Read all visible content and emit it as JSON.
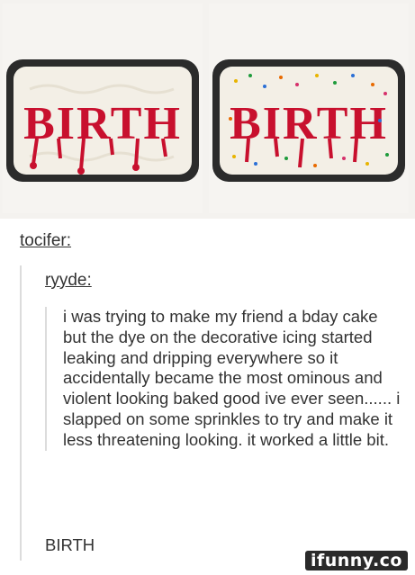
{
  "post": {
    "op_username": "tocifer:",
    "reblog_username": "ryyde:",
    "body_text": "i was trying to make my friend a bday cake but the dye on the decorative icing started leaking and dripping everywhere so it accidentally became the most ominous and violent looking baked good ive ever seen...... i slapped on some sprinkles to try and make it less threatening looking. it worked a little bit.",
    "reply_text": "BIRTH"
  },
  "images": {
    "left_cake_text": "BIRTH",
    "right_cake_text": "BIRTH"
  },
  "watermark": {
    "text": "ifunny.co"
  },
  "colors": {
    "icing_red": "#c8102e",
    "frosting": "#f3efe6",
    "pan": "#2b2b2b"
  }
}
